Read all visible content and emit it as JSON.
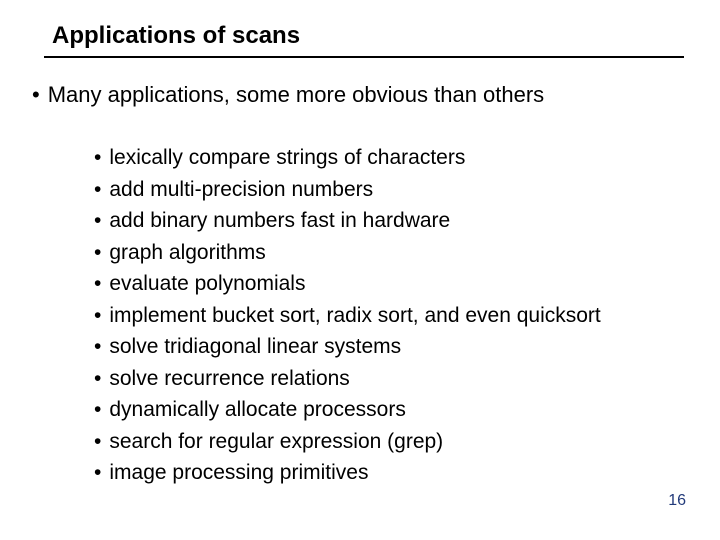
{
  "title": "Applications of scans",
  "lead": "Many applications, some more obvious than others",
  "items": [
    "lexically compare strings of characters",
    "add multi-precision numbers",
    "add binary numbers fast in hardware",
    "graph algorithms",
    "evaluate polynomials",
    "implement bucket sort, radix sort, and even quicksort",
    "solve tridiagonal linear systems",
    "solve recurrence relations",
    "dynamically allocate processors",
    "search for regular expression (grep)",
    "image processing primitives"
  ],
  "page_number": "16"
}
